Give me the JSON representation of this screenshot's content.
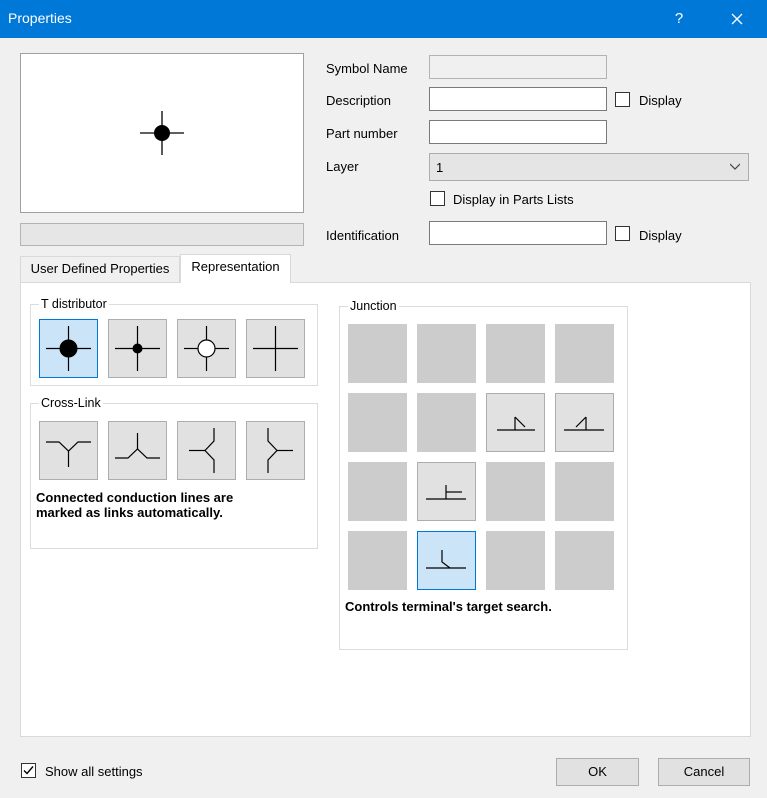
{
  "window": {
    "title": "Properties",
    "help_glyph": "?"
  },
  "fields": {
    "symbol_name": {
      "label": "Symbol Name",
      "value": ""
    },
    "description": {
      "label": "Description",
      "value": "",
      "display_label": "Display"
    },
    "part_number": {
      "label": "Part number",
      "value": ""
    },
    "layer": {
      "label": "Layer",
      "value": "1"
    },
    "parts_list": {
      "label": "Display in Parts Lists"
    },
    "identification": {
      "label": "Identification",
      "value": "",
      "display_label": "Display"
    }
  },
  "tabs": [
    {
      "label": "User Defined Properties"
    },
    {
      "label": "Representation"
    }
  ],
  "groups": {
    "t_distributor": {
      "label": "T distributor"
    },
    "cross_link": {
      "label": "Cross-Link",
      "note_line1": "Connected conduction lines are",
      "note_line2": "marked as links automatically."
    },
    "junction": {
      "label": "Junction",
      "note": "Controls terminal's target search."
    }
  },
  "footer": {
    "show_all": "Show all settings",
    "ok": "OK",
    "cancel": "Cancel"
  },
  "colors": {
    "titlebar": "#0078d7",
    "selected_fill": "#cce4f7",
    "selected_border": "#0078d7"
  },
  "icons": {
    "t_distributor": [
      "junction-dot-large-icon",
      "junction-dot-small-icon",
      "junction-circle-icon",
      "cross-plain-icon"
    ],
    "cross_link": [
      "cross-link-y-icon",
      "cross-link-inverted-y-icon",
      "cross-link-left-icon",
      "cross-link-right-icon"
    ]
  }
}
